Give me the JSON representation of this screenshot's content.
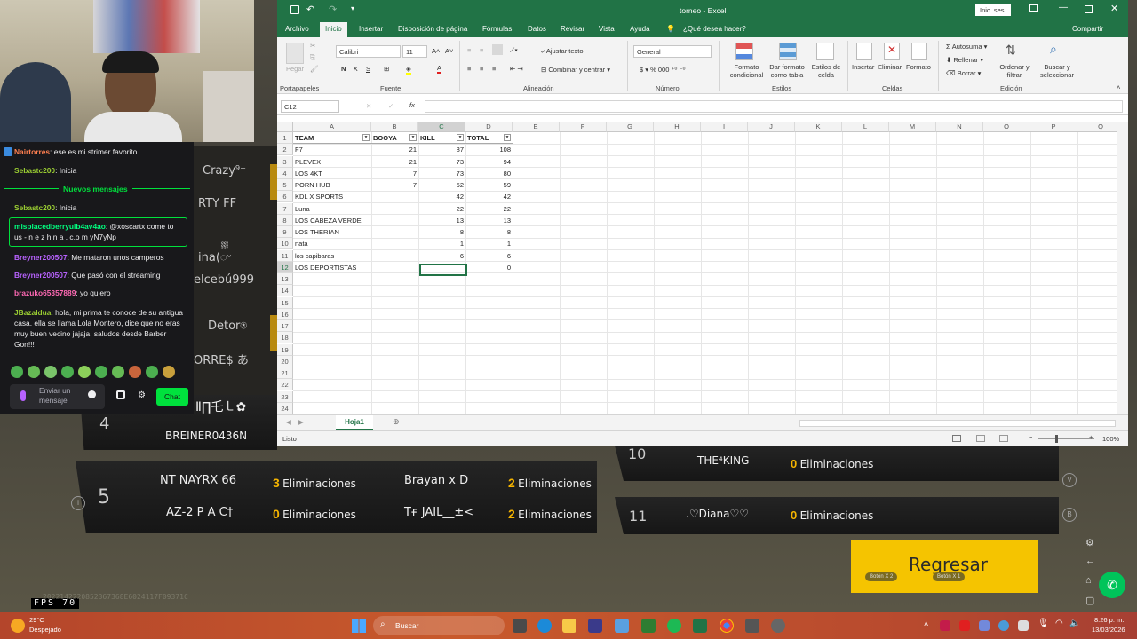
{
  "game": {
    "names_left": [
      "Crazy⁹⁺",
      "RTY FF",
      "ina(ᢆᵕ",
      "elcebú999",
      "Detor⍟",
      "ORRE$ あ",
      "Ⅱ∏乇㇄✿",
      "BREINER0436N"
    ],
    "rank4": "4",
    "team5": {
      "rank": "5",
      "players": [
        {
          "name": "NT NAYRX 66",
          "kills": "3",
          "label": "Eliminaciones"
        },
        {
          "name": "AZ-2 P A C†",
          "kills": "0",
          "label": "Eliminaciones"
        },
        {
          "name": "Brayan x D",
          "kills": "2",
          "label": "Eliminaciones"
        },
        {
          "name": "Tғ JAIL__±<",
          "kills": "2",
          "label": "Eliminaciones"
        }
      ]
    },
    "team10": {
      "rank": "10",
      "name": "THE⁴KING",
      "kills": "0",
      "label": "Eliminaciones"
    },
    "team11": {
      "rank": "11",
      "name": ".♡Diana♡♡",
      "kills": "0",
      "label": "Eliminaciones"
    },
    "back_button": "Regresar",
    "btn_x2": "Botón X 2",
    "btn_x1": "Botón X 1",
    "side_v": "V",
    "side_b": "B",
    "fps_label": "FPS",
    "fps_value": "70",
    "hash": "2022142220852367368E6024117F09371C"
  },
  "chat": {
    "messages_top": [
      {
        "user": "Nairtorres",
        "text": "ese es mi strimer favorito",
        "color": "#ff7f50"
      },
      {
        "user": "Sebastc200",
        "text": "Inicia",
        "color": "#9acd32"
      }
    ],
    "new_messages": "Nuevos mensajes",
    "messages": [
      {
        "user": "Sebastc200",
        "text": "Inicia",
        "color": "#9acd32"
      },
      {
        "user": "misplacedberryulb4av4ao",
        "text": "@xoscartx come to us - n e z h n a . c.o m yN7yNp",
        "color": "#00ff7f"
      },
      {
        "user": "Breyner200507",
        "text": "Me mataron unos camperos",
        "color": "#b862ff"
      },
      {
        "user": "Breyner200507",
        "text": "Que pasó con el streaming",
        "color": "#b862ff"
      },
      {
        "user": "brazuko65357889",
        "text": "yo quiero",
        "color": "#ff69b4"
      },
      {
        "user": "JBazaldua",
        "text": "hola, mi prima te conoce de su antigua casa. ella se llama Lola Montero, dice que no eras muy buen vecino jajaja. saludos desde Barber Gon!!!",
        "color": "#9acd32"
      }
    ],
    "input_placeholder": "Enviar un mensaje",
    "chat_button": "Chat"
  },
  "excel": {
    "title": "torneo  -  Excel",
    "signin": "Inic. ses.",
    "tabs": [
      "Archivo",
      "Inicio",
      "Insertar",
      "Disposición de página",
      "Fórmulas",
      "Datos",
      "Revisar",
      "Vista",
      "Ayuda"
    ],
    "tell_me": "¿Qué desea hacer?",
    "share": "Compartir",
    "ribbon": {
      "paste": "Pegar",
      "font_name": "Calibri",
      "font_size": "11",
      "wrap_text": "Ajustar texto",
      "merge_center": "Combinar y centrar",
      "number_format": "General",
      "cond_format": "Formato condicional",
      "format_table": "Dar formato como tabla",
      "cell_styles": "Estilos de celda",
      "insert": "Insertar",
      "delete": "Eliminar",
      "format": "Formato",
      "autosum": "Autosuma",
      "fill": "Rellenar",
      "clear": "Borrar",
      "sort_filter": "Ordenar y filtrar",
      "find_select": "Buscar y seleccionar",
      "groups": [
        "Portapapeles",
        "Fuente",
        "Alineación",
        "Número",
        "Estilos",
        "Celdas",
        "Edición"
      ]
    },
    "name_box": "C12",
    "fx": "fx",
    "columns": [
      "A",
      "B",
      "C",
      "D",
      "E",
      "F",
      "G",
      "H",
      "I",
      "J",
      "K",
      "L",
      "M",
      "N",
      "O",
      "P",
      "Q"
    ],
    "row_numbers": [
      "1",
      "2",
      "3",
      "4",
      "5",
      "6",
      "7",
      "8",
      "9",
      "10",
      "11",
      "12",
      "13",
      "14",
      "15",
      "16",
      "17",
      "18",
      "19",
      "20",
      "21",
      "22",
      "23",
      "24"
    ],
    "headers": [
      "TEAM",
      "BOOYA",
      "KILL",
      "TOTAL"
    ],
    "rows": [
      {
        "team": "F7",
        "booya": "21",
        "kill": "87",
        "total": "108"
      },
      {
        "team": "PLEVEX",
        "booya": "21",
        "kill": "73",
        "total": "94"
      },
      {
        "team": "LOS 4KT",
        "booya": "7",
        "kill": "73",
        "total": "80"
      },
      {
        "team": "PORN HUB",
        "booya": "7",
        "kill": "52",
        "total": "59"
      },
      {
        "team": "KDL X SPORTS",
        "booya": "",
        "kill": "42",
        "total": "42"
      },
      {
        "team": "Luna",
        "booya": "",
        "kill": "22",
        "total": "22"
      },
      {
        "team": "LOS CABEZA VERDE",
        "booya": "",
        "kill": "13",
        "total": "13"
      },
      {
        "team": "LOS THERIAN",
        "booya": "",
        "kill": "8",
        "total": "8"
      },
      {
        "team": "nata",
        "booya": "",
        "kill": "1",
        "total": "1"
      },
      {
        "team": "los capibaras",
        "booya": "",
        "kill": "6",
        "total": "6"
      },
      {
        "team": "LOS DEPORTISTAS",
        "booya": "",
        "kill": "",
        "total": "0"
      }
    ],
    "sheet_tab": "Hoja1",
    "status": "Listo",
    "zoom": "100%"
  },
  "taskbar": {
    "temperature": "29°C",
    "weather": "Despejado",
    "search": "Buscar",
    "time": "8:26 p. m.",
    "date": "13/03/2026"
  },
  "colors": {
    "excel_green": "#217346",
    "chat_bg": "#18181b",
    "chat_button": "#00e13d",
    "accent_yellow": "#f5b400"
  }
}
